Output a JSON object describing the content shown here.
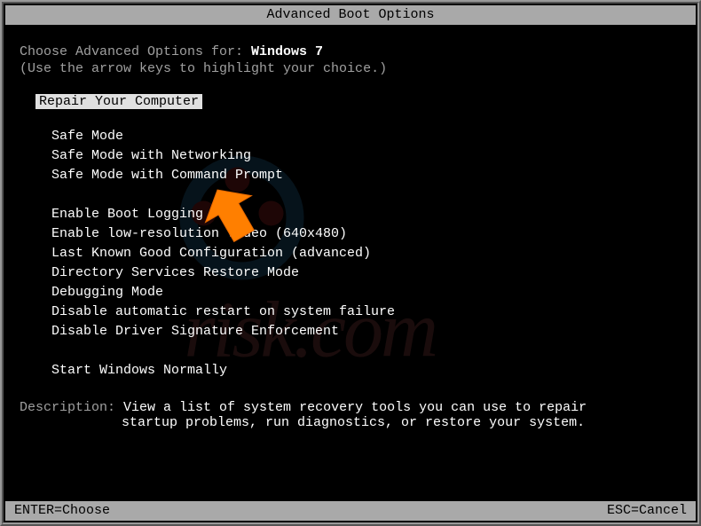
{
  "title": "Advanced Boot Options",
  "instruction_prefix": "Choose Advanced Options for: ",
  "os_name": "Windows 7",
  "instruction_hint": "(Use the arrow keys to highlight your choice.)",
  "selected_option": "Repair Your Computer",
  "options": {
    "group1": [
      "Safe Mode",
      "Safe Mode with Networking",
      "Safe Mode with Command Prompt"
    ],
    "group2": [
      "Enable Boot Logging",
      "Enable low-resolution video (640x480)",
      "Last Known Good Configuration (advanced)",
      "Directory Services Restore Mode",
      "Debugging Mode",
      "Disable automatic restart on system failure",
      "Disable Driver Signature Enforcement"
    ],
    "group3": [
      "Start Windows Normally"
    ]
  },
  "description": {
    "label": "Description: ",
    "line1": "View a list of system recovery tools you can use to repair",
    "line2": "startup problems, run diagnostics, or restore your system."
  },
  "footer": {
    "left": "ENTER=Choose",
    "right": "ESC=Cancel"
  },
  "watermark_text": "risk.com"
}
